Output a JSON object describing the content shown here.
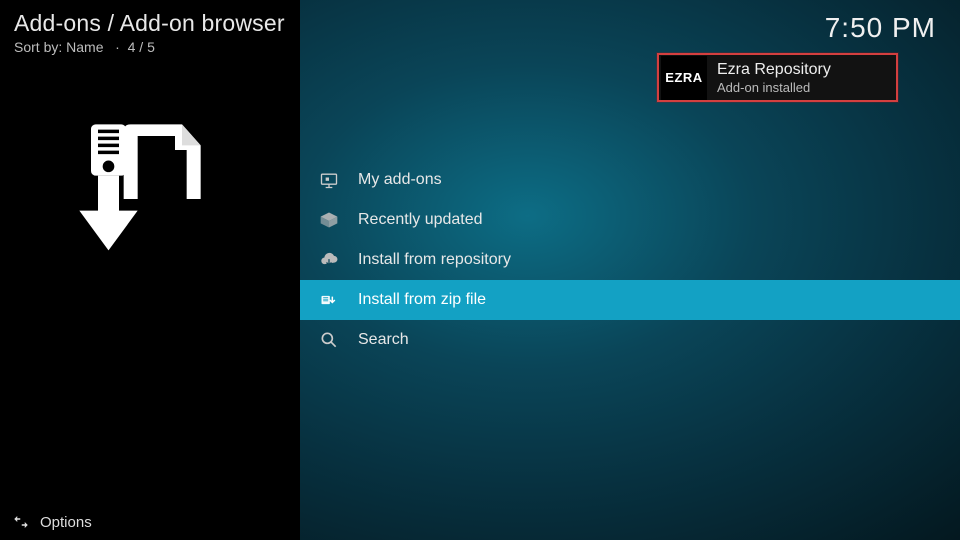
{
  "header": {
    "breadcrumb": "Add-ons / Add-on browser",
    "sort_prefix": "Sort by: ",
    "sort_value": "Name",
    "position": "4 / 5"
  },
  "clock": "7:50 PM",
  "menu": {
    "items": [
      {
        "label": "My add-ons",
        "icon": "monitor-addon-icon",
        "selected": false
      },
      {
        "label": "Recently updated",
        "icon": "box-open-icon",
        "selected": false
      },
      {
        "label": "Install from repository",
        "icon": "cloud-download-icon",
        "selected": false
      },
      {
        "label": "Install from zip file",
        "icon": "zip-install-icon",
        "selected": true
      },
      {
        "label": "Search",
        "icon": "search-icon",
        "selected": false
      }
    ]
  },
  "toast": {
    "thumb_text": "EZRA",
    "title": "Ezra Repository",
    "subtitle": "Add-on installed"
  },
  "footer": {
    "options_label": "Options"
  }
}
